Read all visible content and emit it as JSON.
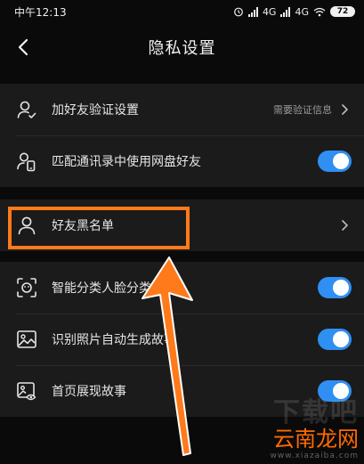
{
  "status_bar": {
    "time": "中午12:13",
    "network1": "4G",
    "network2": "4G",
    "battery": "72"
  },
  "header": {
    "title": "隐私设置"
  },
  "groups": [
    {
      "items": [
        {
          "label": "加好友验证设置",
          "value": "需要验证信息",
          "control": "chevron",
          "icon": "user-check-icon"
        },
        {
          "label": "匹配通讯录中使用网盘好友",
          "control": "toggle",
          "toggle_on": true,
          "icon": "contacts-phone-icon"
        }
      ]
    },
    {
      "items": [
        {
          "label": "好友黑名单",
          "control": "chevron",
          "icon": "user-icon"
        }
      ]
    },
    {
      "items": [
        {
          "label": "智能分类人脸分类",
          "control": "toggle",
          "toggle_on": true,
          "icon": "face-scan-icon"
        },
        {
          "label": "识别照片自动生成故事",
          "control": "toggle",
          "toggle_on": true,
          "icon": "photo-icon"
        },
        {
          "label": "首页展现故事",
          "control": "toggle",
          "toggle_on": true,
          "icon": "photo-eye-icon"
        }
      ]
    }
  ],
  "annotation": {
    "highlight_color": "#ff7a1a"
  },
  "watermark": {
    "top": "下载吧",
    "middle": "云南龙网",
    "bottom": "www.xiazaiba.com"
  },
  "colors": {
    "background": "#0a0a0a",
    "row_background": "#1b1b1b",
    "toggle_on": "#2f8ff2"
  }
}
